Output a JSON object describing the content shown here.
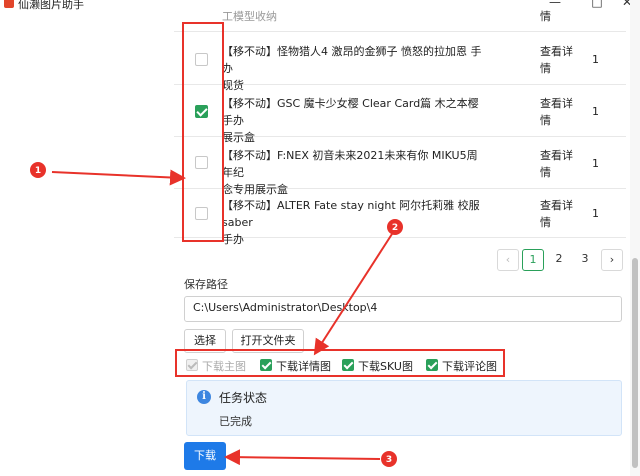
{
  "window": {
    "title": "仙濑图片助手",
    "minimize": "—",
    "maximize": "□",
    "close": "✕"
  },
  "table": {
    "partial_row": {
      "name": "工模型收纳",
      "detail": "情"
    },
    "rows": [
      {
        "checked": false,
        "name_line1": "【移不动】怪物猎人4 激昂的金狮子 愤怒的拉加恩 手办",
        "name_line2": "现货",
        "detail_line1": "查看详",
        "detail_line2": "情",
        "qty": "1"
      },
      {
        "checked": true,
        "name_line1": "【移不动】GSC 魔卡少女樱 Clear Card篇 木之本樱 手办",
        "name_line2": "展示盒",
        "detail_line1": "查看详",
        "detail_line2": "情",
        "qty": "1"
      },
      {
        "checked": false,
        "name_line1": "【移不动】F:NEX 初音未来2021未来有你 MIKU5周年纪",
        "name_line2": "念专用展示盒",
        "detail_line1": "查看详",
        "detail_line2": "情",
        "qty": "1"
      },
      {
        "checked": false,
        "name_line1": "【移不动】ALTER Fate stay night 阿尔托莉雅 校服saber",
        "name_line2": "手办",
        "detail_line1": "查看详",
        "detail_line2": "情",
        "qty": "1"
      }
    ]
  },
  "pagination": {
    "prev": "‹",
    "pages": [
      "1",
      "2",
      "3"
    ],
    "current": "1",
    "next": "›"
  },
  "save": {
    "label": "保存路径",
    "path": "C:\\Users\\Administrator\\Desktop\\4",
    "choose_label": "选择",
    "open_folder_label": "打开文件夹"
  },
  "options": [
    {
      "label": "下载主图",
      "checked": true,
      "disabled": true
    },
    {
      "label": "下载详情图",
      "checked": true,
      "disabled": false
    },
    {
      "label": "下载SKU图",
      "checked": true,
      "disabled": false
    },
    {
      "label": "下载评论图",
      "checked": true,
      "disabled": false
    }
  ],
  "status": {
    "title": "任务状态",
    "text": "已完成",
    "icon": "info-icon"
  },
  "download_label": "下载",
  "callouts": [
    "1",
    "2",
    "3"
  ],
  "colors": {
    "accent_green": "#2aa05a",
    "primary_blue": "#1e7ae8",
    "annotation_red": "#e8322a"
  }
}
